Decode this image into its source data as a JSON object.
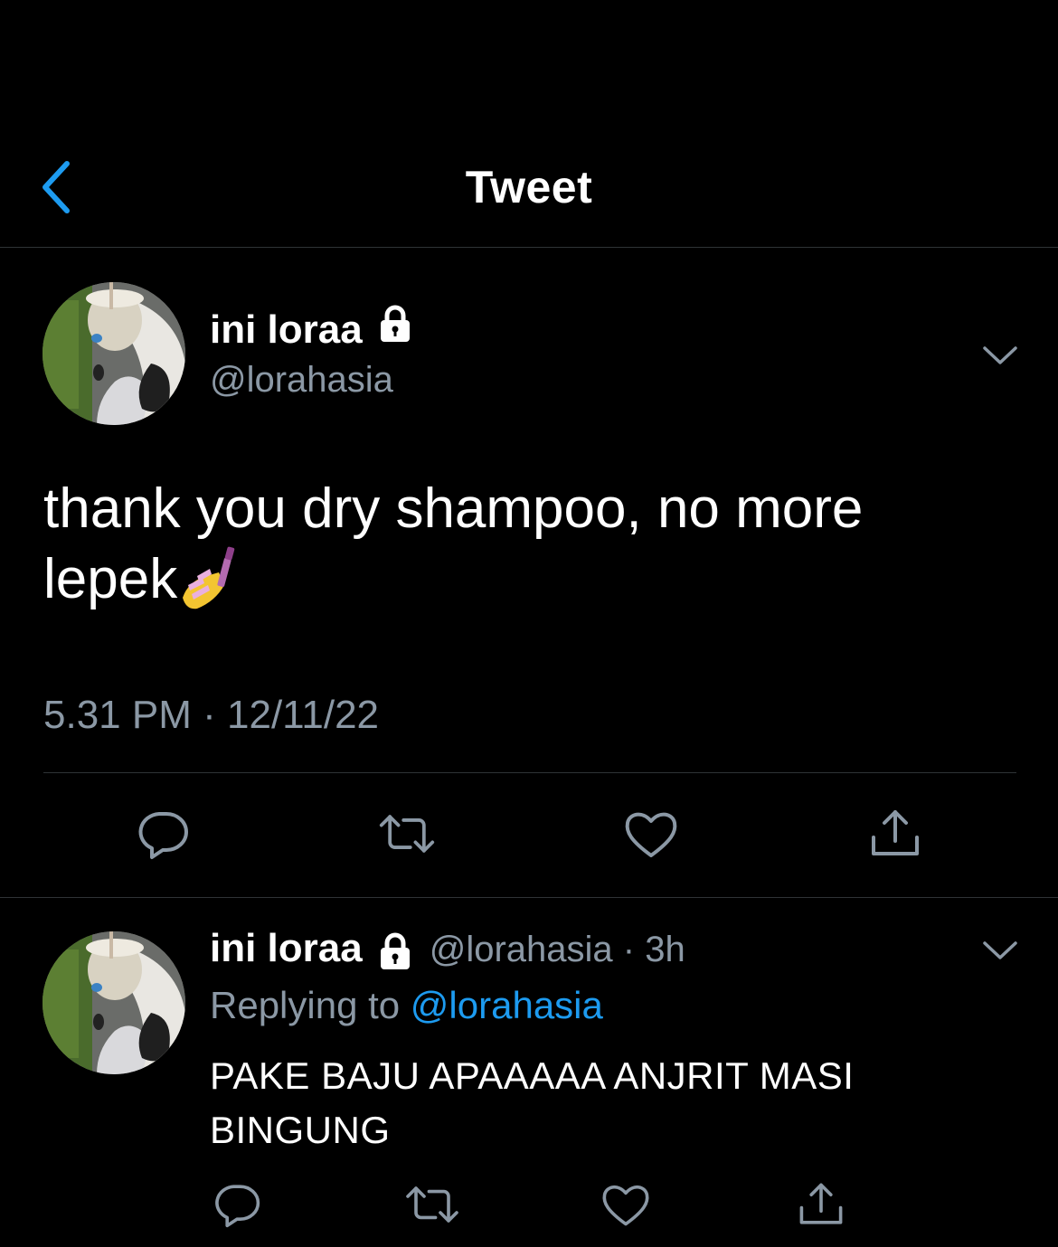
{
  "header": {
    "title": "Tweet"
  },
  "tweet": {
    "display_name": "ini loraa",
    "handle": "@lorahasia",
    "text": "thank you dry shampoo, no more lepek",
    "emoji": "nail-polish",
    "time": "5.31 PM",
    "date": "12/11/22",
    "meta_separator": "·"
  },
  "reply": {
    "display_name": "ini loraa",
    "handle": "@lorahasia",
    "age": "3h",
    "meta_separator": "·",
    "replying_prefix": "Replying to",
    "replying_to": "@lorahasia",
    "text": "PAKE BAJU APAAAAA ANJRIT MASI BINGUNG"
  },
  "colors": {
    "background": "#000000",
    "accent": "#1d9bf0",
    "secondary_text": "#8b98a5",
    "divider": "#2f3336"
  },
  "icons": [
    "back-chevron-icon",
    "lock-icon",
    "chevron-down-icon",
    "reply-icon",
    "retweet-icon",
    "like-icon",
    "share-icon"
  ]
}
